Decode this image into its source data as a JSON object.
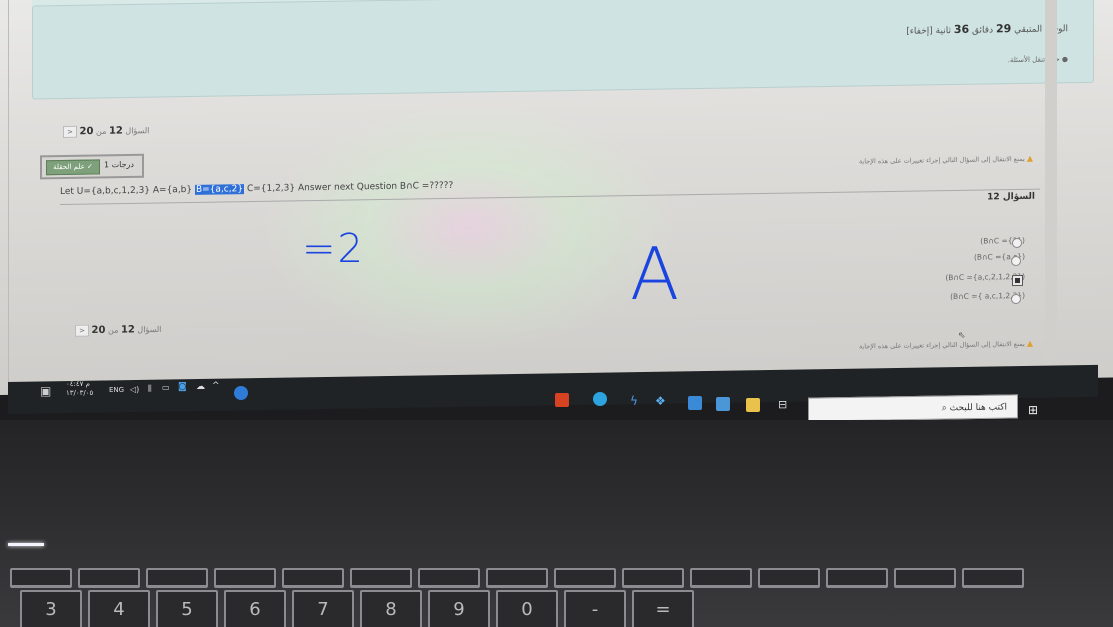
{
  "banner": {
    "timer_prefix": "الوقت المتبقي",
    "timer_minutes": "29",
    "timer_min_label": "دقائق",
    "timer_seconds": "36",
    "timer_sec_label": "ثانية [إخفاء]",
    "nav_state": "● حالة تنقل الأسئلة."
  },
  "question": {
    "counter_label": "السؤال",
    "counter_current": "12",
    "counter_of": "من",
    "counter_total": "20",
    "flag_label": "علم الحقلة ✓",
    "points": "1 درجات",
    "text_before": "Let   U={a,b,c,1,2,3} A={a,b} ",
    "text_highlight": "B={a,c,2}",
    "text_after": " C={1,2,3} Answer next Question B∩C =?????",
    "label": "السؤال 12",
    "warning": "يمنع الانتقال إلى السؤال التالي إجراء تغييرات على هذه الإجابة",
    "options": [
      "(B∩C ={2})",
      "(B∩C ={a,c})",
      "(B∩C ={a,c,2,1,2,3})",
      "(B∩C ={ a,c,1,2,3})"
    ],
    "selected_index": 2
  },
  "handwriting": {
    "answer": "=2",
    "choice": "A"
  },
  "taskbar": {
    "time": "م ٠٤:٤٧",
    "date": "١٣/٠٣/٠٥",
    "lang": "ENG",
    "search_placeholder": "اكتب هنا للبحث"
  },
  "keyboard": {
    "row1": [
      "",
      "",
      "",
      "",
      "",
      "",
      "",
      "",
      "",
      "",
      "",
      "",
      "",
      "",
      ""
    ],
    "row2": [
      "3",
      "4",
      "5",
      "6",
      "7",
      "8",
      "9",
      "0",
      "-",
      "="
    ]
  }
}
